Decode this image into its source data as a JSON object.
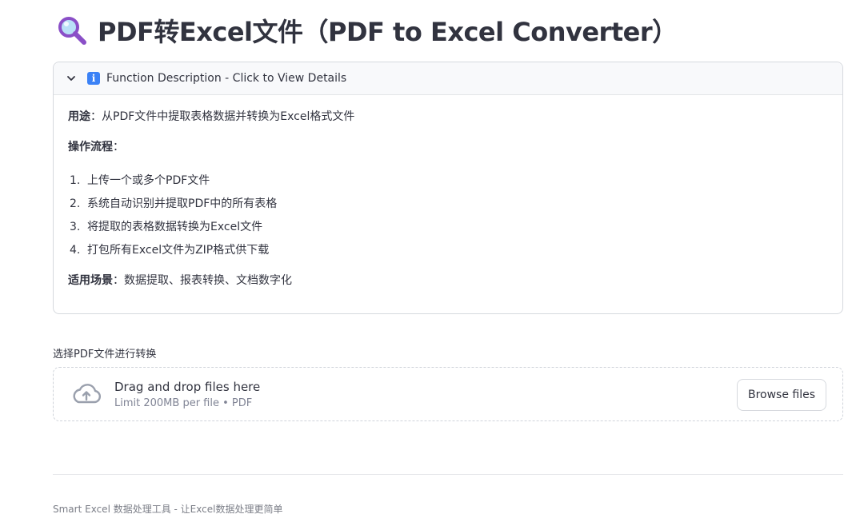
{
  "page": {
    "title": "PDF转Excel文件（PDF to Excel Converter）",
    "title_icon": "magnifier-icon"
  },
  "expander": {
    "label": "Function Description - Click to View Details",
    "expanded": true,
    "usage_label": "用途",
    "usage_text": "从PDF文件中提取表格数据并转换为Excel格式文件",
    "flow_label": "操作流程",
    "steps": [
      {
        "num": "1.",
        "text": "上传一个或多个PDF文件"
      },
      {
        "num": "2.",
        "text": "系统自动识别并提取PDF中的所有表格"
      },
      {
        "num": "3.",
        "text": "将提取的表格数据转换为Excel文件"
      },
      {
        "num": "4.",
        "text": "打包所有Excel文件为ZIP格式供下载"
      }
    ],
    "scenario_label": "适用场景",
    "scenario_text": "数据提取、报表转换、文档数字化",
    "colon": "："
  },
  "uploader": {
    "label": "选择PDF文件进行转换",
    "drag_text": "Drag and drop files here",
    "limit_text": "Limit 200MB per file • PDF",
    "browse_label": "Browse files"
  },
  "footer": {
    "text": "Smart Excel 数据处理工具 - 让Excel数据处理更简单"
  },
  "colors": {
    "info_icon": "#3b82f6",
    "text": "#31333f",
    "muted": "#808495"
  }
}
